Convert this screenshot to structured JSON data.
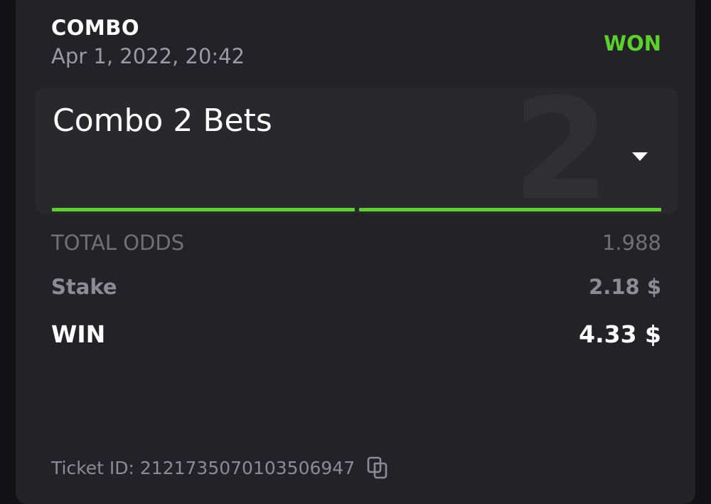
{
  "bet": {
    "type": "COMBO",
    "date": "Apr 1, 2022, 20:42",
    "status": "WON"
  },
  "combo": {
    "title": "Combo 2 Bets",
    "count": "2",
    "legs_won": 2,
    "legs_total": 2
  },
  "summary": {
    "total_odds_label": "TOTAL ODDS",
    "total_odds_value": "1.988",
    "stake_label": "Stake",
    "stake_value": "2.18 $",
    "win_label": "WIN",
    "win_value": "4.33 $"
  },
  "ticket": {
    "label": "Ticket ID: 2121735070103506947"
  },
  "colors": {
    "won_green": "#5bd12b",
    "card_bg": "#232327",
    "page_bg": "#121214"
  },
  "icons": {
    "dropdown": "caret-down-icon",
    "copy": "copy-icon"
  }
}
